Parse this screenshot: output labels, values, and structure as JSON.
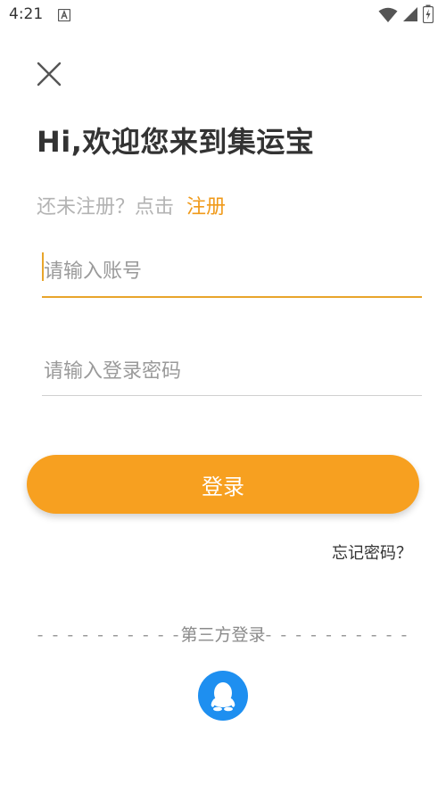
{
  "status_bar": {
    "time": "4:21",
    "icons": [
      "notification-a-icon",
      "wifi-icon",
      "signal-icon",
      "battery-charging-icon"
    ]
  },
  "header": {
    "close_icon": "close-icon",
    "title": "Hi,欢迎您来到集运宝"
  },
  "register": {
    "prompt": "还未注册？点击",
    "link": "注册"
  },
  "form": {
    "account_placeholder": "请输入账号",
    "account_value": "",
    "password_placeholder": "请输入登录密码",
    "password_value": "",
    "login_label": "登录",
    "forgot_label": "忘记密码？"
  },
  "third_party": {
    "label": "第三方登录",
    "dashes": "- - - - - - - - - -",
    "providers": [
      "qq-icon"
    ]
  },
  "colors": {
    "accent": "#f7a020",
    "link": "#f09a1a",
    "qq_blue": "#1e8ff0"
  }
}
